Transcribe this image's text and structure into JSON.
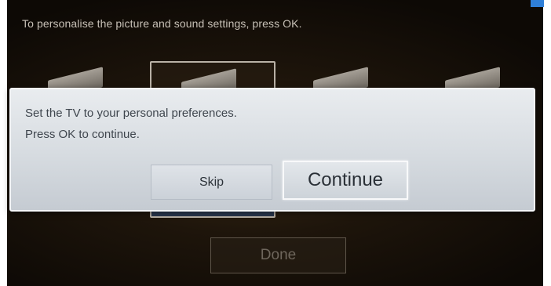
{
  "screen": {
    "banner": "To personalise the picture and sound settings, press OK."
  },
  "steps": {
    "count_visible": 4,
    "selected_index": 1
  },
  "dialog": {
    "line1": "Set the TV to your personal preferences.",
    "line2": "Press OK to continue.",
    "skip_label": "Skip",
    "continue_label": "Continue"
  },
  "footer": {
    "done_label": "Done"
  },
  "colors": {
    "background": "#1e150b",
    "dialog": "#d6dbe0",
    "accent": "#2f7fd8"
  },
  "icons": {
    "tile": "tv-settings-icon"
  }
}
